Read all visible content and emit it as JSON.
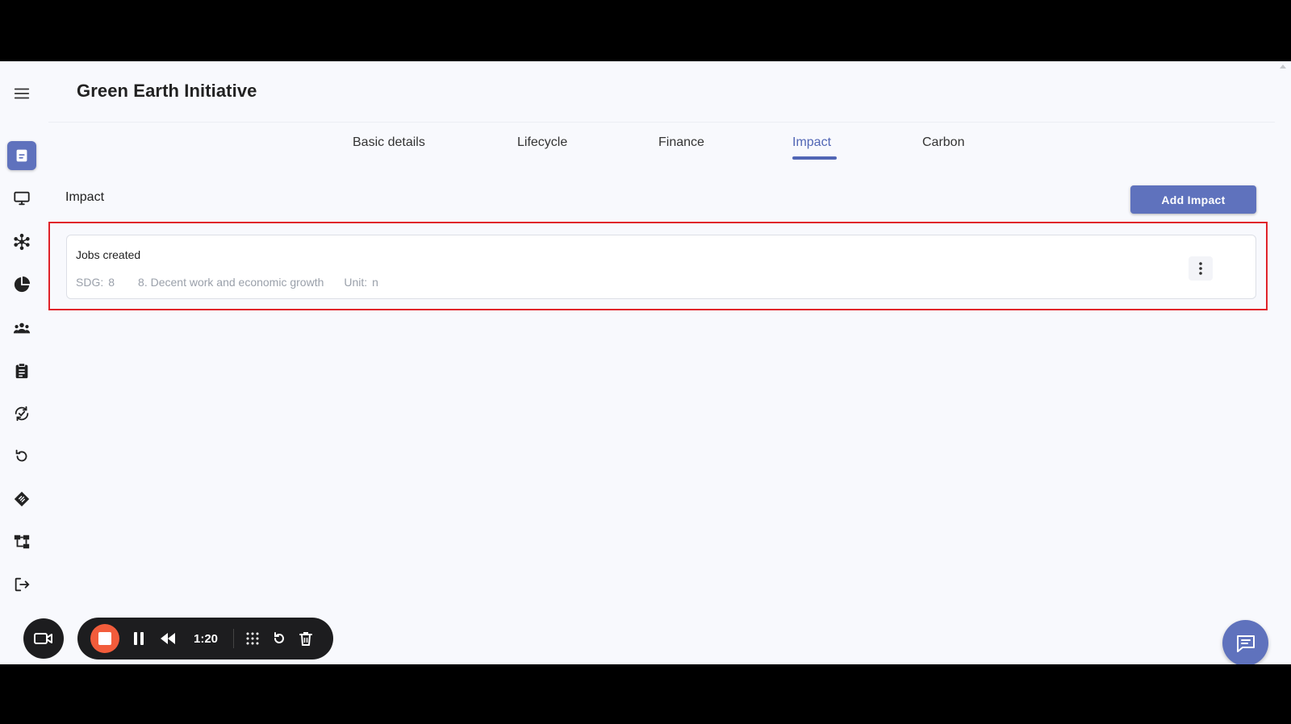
{
  "app": {
    "title": "Green Earth Initiative"
  },
  "sidebar": {
    "items": [
      {
        "icon": "menu-icon"
      },
      {
        "icon": "document-icon",
        "active": true
      },
      {
        "icon": "monitor-icon"
      },
      {
        "icon": "network-icon"
      },
      {
        "icon": "pie-chart-icon"
      },
      {
        "icon": "group-icon"
      },
      {
        "icon": "clipboard-icon"
      },
      {
        "icon": "sync-check-icon"
      },
      {
        "icon": "refresh-icon"
      },
      {
        "icon": "tag-icon"
      },
      {
        "icon": "hierarchy-icon"
      },
      {
        "icon": "logout-icon"
      }
    ]
  },
  "tabs": [
    {
      "label": "Basic details"
    },
    {
      "label": "Lifecycle"
    },
    {
      "label": "Finance"
    },
    {
      "label": "Impact",
      "active": true
    },
    {
      "label": "Carbon"
    }
  ],
  "section": {
    "label": "Impact",
    "add_button": "Add Impact"
  },
  "impact_items": [
    {
      "title": "Jobs created",
      "sdg_label": "SDG:",
      "sdg_value": "8",
      "goal": "8. Decent work and economic growth",
      "unit_label": "Unit:",
      "unit_value": "n"
    }
  ],
  "recorder": {
    "time": "1:20"
  },
  "colors": {
    "accent": "#5f72bd",
    "active_tab": "#5166b5",
    "highlight": "#e0232a",
    "record": "#f25c3b"
  }
}
